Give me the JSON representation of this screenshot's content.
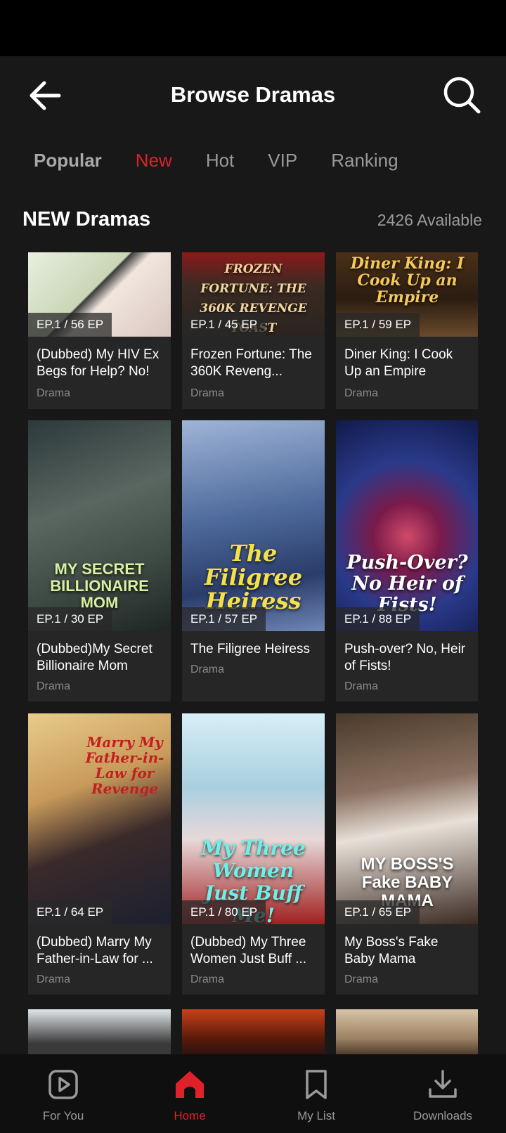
{
  "header": {
    "title": "Browse Dramas"
  },
  "tabs": [
    {
      "label": "Popular"
    },
    {
      "label": "New"
    },
    {
      "label": "Hot"
    },
    {
      "label": "VIP"
    },
    {
      "label": "Ranking"
    }
  ],
  "active_tab": "New",
  "section": {
    "title": "NEW Dramas",
    "count": "2426 Available"
  },
  "dramas": [
    {
      "name": "(Dubbed) My HIV Ex Begs for Help? No!",
      "episodes": "EP.1 / 56 EP",
      "genre": "Drama",
      "poster_text": ""
    },
    {
      "name": "Frozen Fortune: The 360K Reveng...",
      "episodes": "EP.1 / 45 EP",
      "genre": "Drama",
      "poster_text": "FROZEN FORTUNE: THE 360K REVENGE TOAST"
    },
    {
      "name": "Diner King: I Cook Up an Empire",
      "episodes": "EP.1 / 59 EP",
      "genre": "Drama",
      "poster_text": "Diner King: I Cook Up an Empire"
    },
    {
      "name": "(Dubbed)My Secret Billionaire Mom",
      "episodes": "EP.1 / 30 EP",
      "genre": "Drama",
      "poster_text": "MY SECRET BILLIONAIRE MOM"
    },
    {
      "name": "The Filigree Heiress",
      "episodes": "EP.1 / 57 EP",
      "genre": "Drama",
      "poster_text": "The Filigree Heiress"
    },
    {
      "name": "Push-over? No, Heir of Fists!",
      "episodes": "EP.1 / 88 EP",
      "genre": "Drama",
      "poster_text": "Push-Over? No Heir of Fists!"
    },
    {
      "name": "(Dubbed) Marry My Father-in-Law for ...",
      "episodes": "EP.1 / 64 EP",
      "genre": "Drama",
      "poster_text": "Marry My Father-in-Law for Revenge"
    },
    {
      "name": "(Dubbed) My Three Women Just Buff ...",
      "episodes": "EP.1 / 80 EP",
      "genre": "Drama",
      "poster_text": "My Three Women Just Buff Me!"
    },
    {
      "name": "My Boss's Fake Baby Mama",
      "episodes": "EP.1 / 65 EP",
      "genre": "Drama",
      "poster_text": "MY BOSS'S Fake BABY MAMA"
    }
  ],
  "bottom_nav": [
    {
      "label": "For You",
      "icon": "play-icon"
    },
    {
      "label": "Home",
      "icon": "home-icon"
    },
    {
      "label": "My List",
      "icon": "bookmark-icon"
    },
    {
      "label": "Downloads",
      "icon": "download-icon"
    }
  ],
  "colors": {
    "accent": "#e0202a",
    "background": "#181818",
    "card": "#262626"
  }
}
